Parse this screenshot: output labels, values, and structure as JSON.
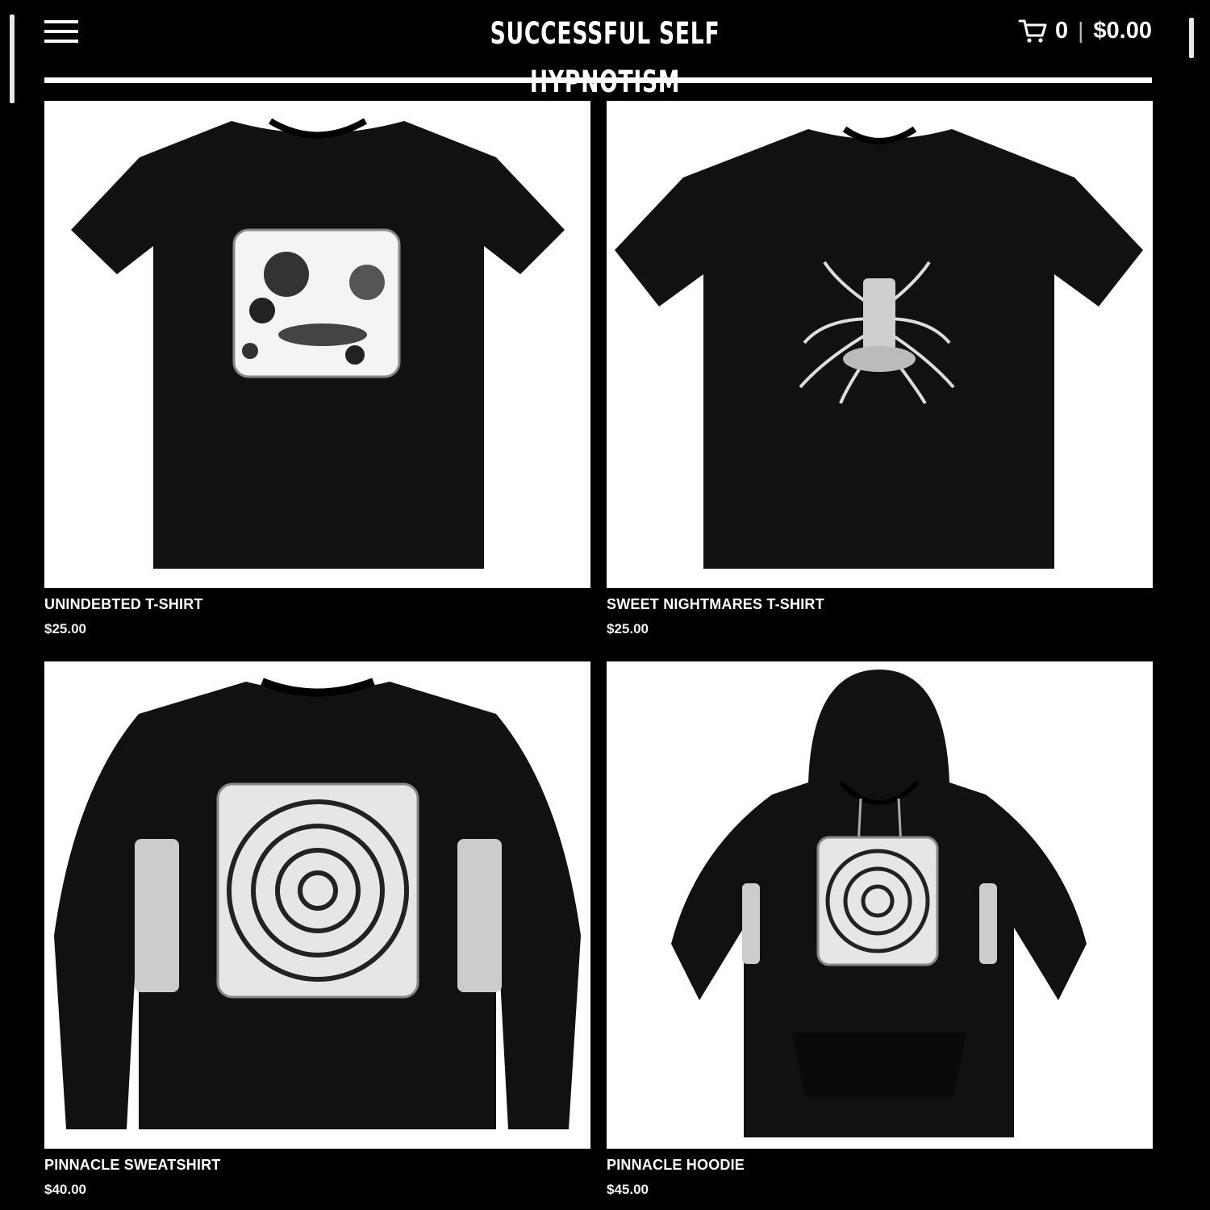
{
  "header": {
    "logo_text": "SUCCESSFUL SELF HYPNOTISM",
    "menu_icon": "hamburger-menu-icon",
    "cart": {
      "icon": "cart-icon",
      "count": "0",
      "separator": "|",
      "total": "$0.00"
    }
  },
  "products": [
    {
      "title": "UNINDEBTED T-SHIRT",
      "price": "$25.00",
      "garment": "t-shirt"
    },
    {
      "title": "SWEET NIGHTMARES T-SHIRT",
      "price": "$25.00",
      "garment": "t-shirt"
    },
    {
      "title": "PINNACLE SWEATSHIRT",
      "price": "$40.00",
      "garment": "sweatshirt"
    },
    {
      "title": "PINNACLE HOODIE",
      "price": "$45.00",
      "garment": "hoodie"
    }
  ],
  "colors": {
    "background": "#000000",
    "card_background": "#ffffff",
    "garment": "#111111",
    "text": "#ffffff"
  }
}
